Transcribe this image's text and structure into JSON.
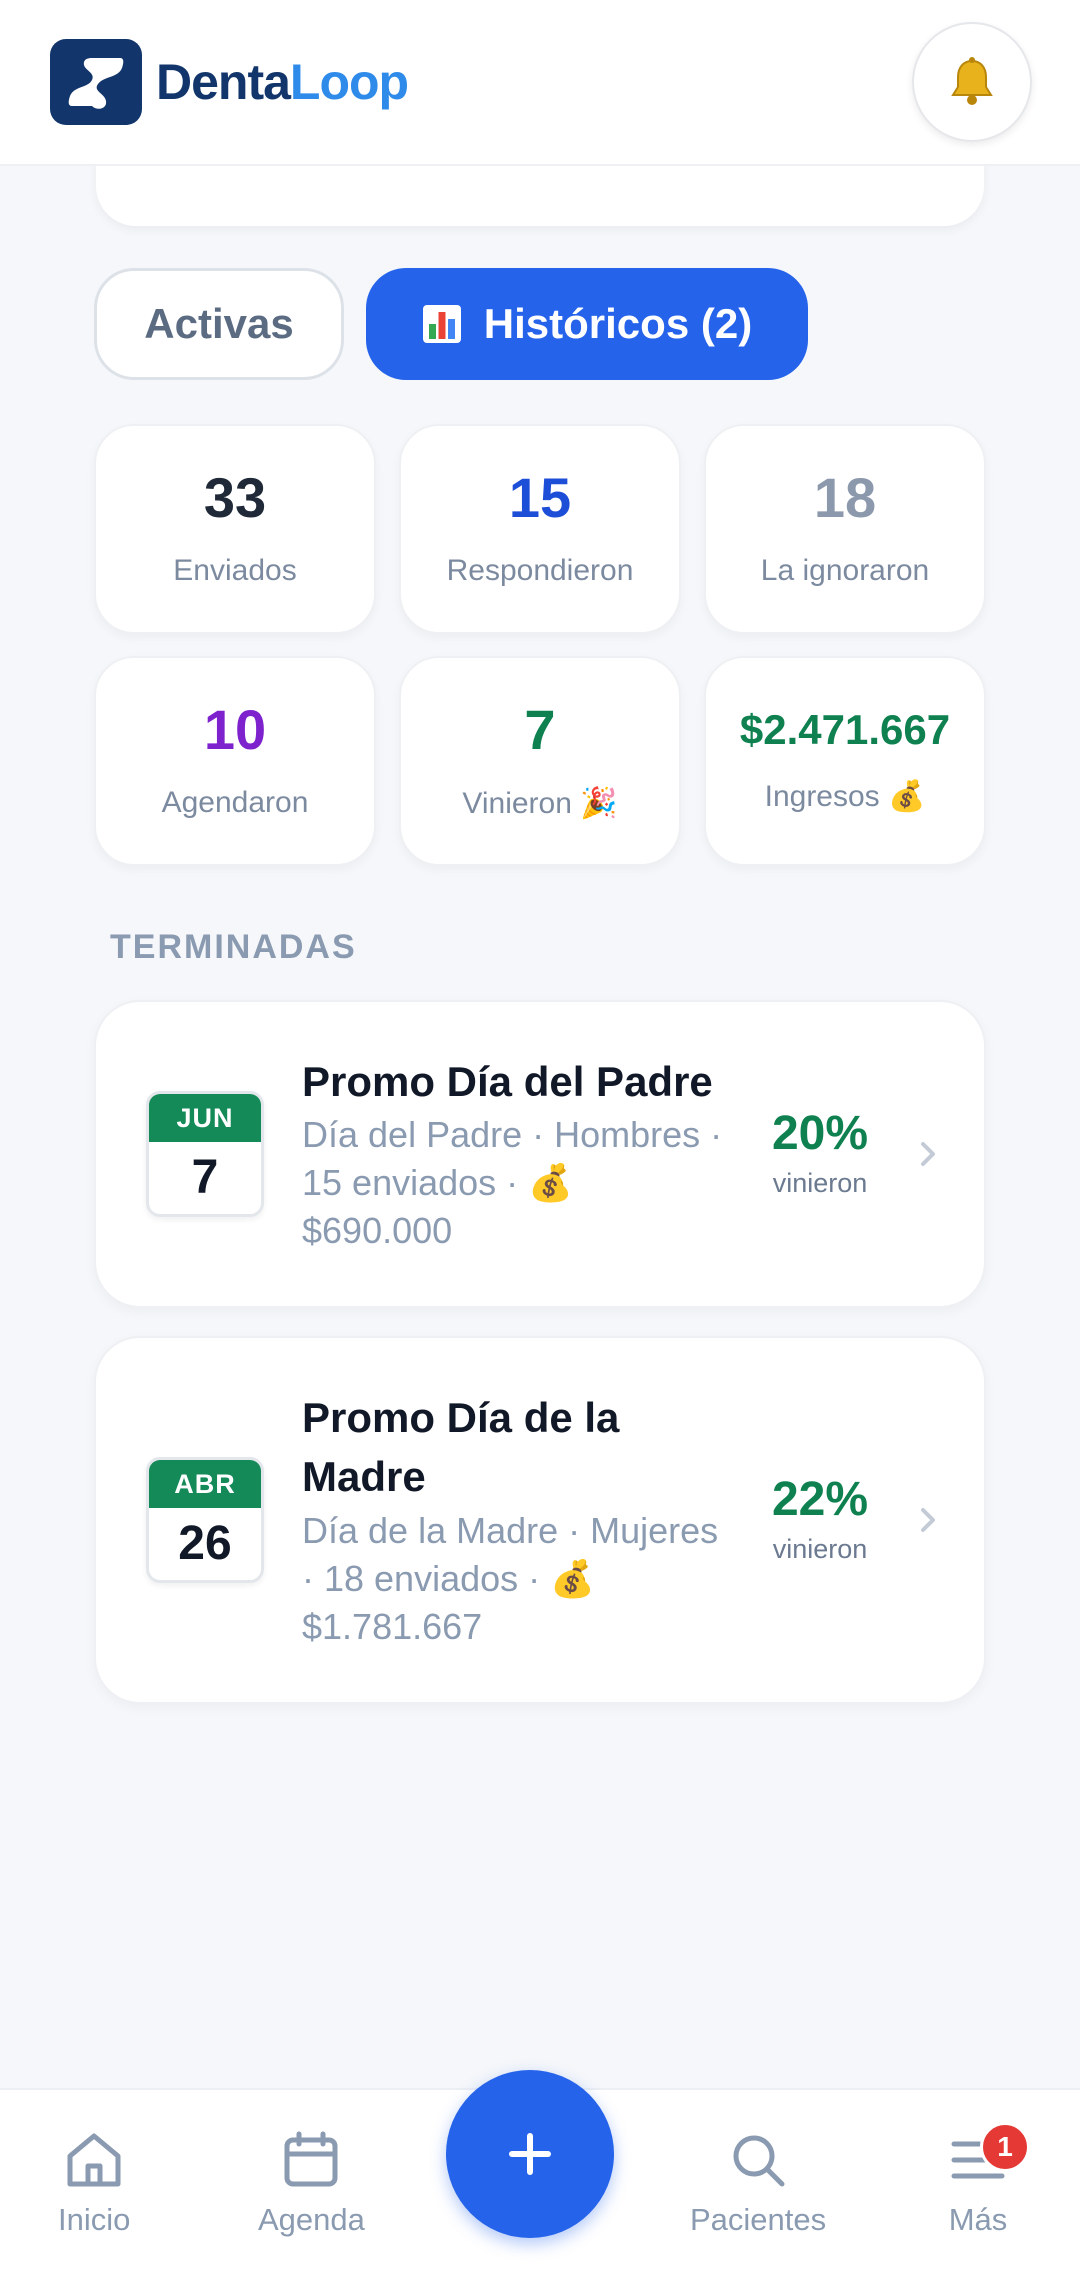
{
  "header": {
    "brand_part1": "Denta",
    "brand_part2": "Loop",
    "notifications_icon": "bell-icon"
  },
  "tabs": {
    "activas": "Activas",
    "historicos": "Históricos (2)",
    "historicos_icon": "bar-chart-icon"
  },
  "stats": [
    {
      "value": "33",
      "label": "Enviados",
      "color": "#1f2937"
    },
    {
      "value": "15",
      "label": "Respondieron",
      "color": "#1d4ed8"
    },
    {
      "value": "18",
      "label": "La ignoraron",
      "color": "#8c99ad"
    },
    {
      "value": "10",
      "label": "Agendaron",
      "color": "#7e22ce"
    },
    {
      "value": "7",
      "label": "Vinieron 🎉",
      "color": "#0f8150"
    },
    {
      "value": "$2.471.667",
      "label": "Ingresos 💰",
      "color": "#0f8150"
    }
  ],
  "section_title": "TERMINADAS",
  "campaigns": [
    {
      "month": "JUN",
      "day": "7",
      "title": "Promo Día del Padre",
      "meta_line1": "Día del Padre · Hombres ·",
      "meta_line2": "15 enviados · 💰",
      "meta_line3": "$690.000",
      "percent": "20%",
      "percent_label": "vinieron"
    },
    {
      "month": "ABR",
      "day": "26",
      "title_line1": "Promo Día de la",
      "title_line2": "Madre",
      "meta_line1": "Día de la Madre · Mujeres",
      "meta_line2": "· 18 enviados · 💰",
      "meta_line3": "$1.781.667",
      "percent": "22%",
      "percent_label": "vinieron"
    }
  ],
  "nav": {
    "inicio": "Inicio",
    "agenda": "Agenda",
    "pacientes": "Pacientes",
    "mas": "Más",
    "mas_badge": "1",
    "fab_label": "+"
  },
  "colors": {
    "primary": "#2563eb",
    "brand_dark": "#12366b",
    "brand_light": "#2f8bea",
    "success": "#0f8150"
  }
}
